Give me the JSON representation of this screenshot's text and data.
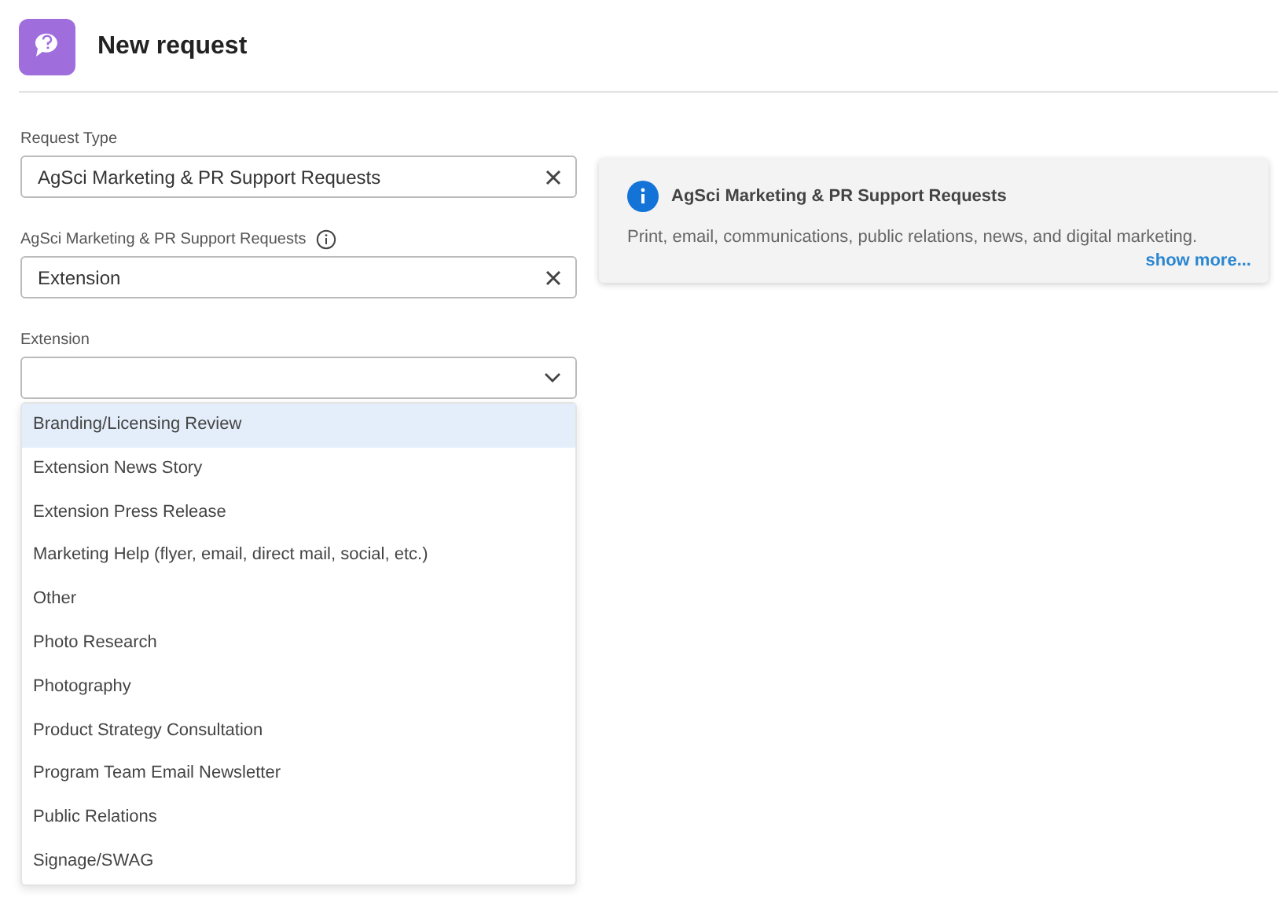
{
  "header": {
    "title": "New request"
  },
  "fields": [
    {
      "kind": "select",
      "label": "Request Type",
      "value": "AgSci Marketing & PR Support Requests",
      "info": false,
      "clearable": true,
      "expanded": false
    },
    {
      "kind": "select",
      "label": "AgSci Marketing & PR Support Requests",
      "value": "Extension",
      "info": true,
      "clearable": true,
      "expanded": false
    },
    {
      "kind": "select",
      "label": "Extension",
      "info": false,
      "clearable": false,
      "expanded": true
    }
  ],
  "dropdown": {
    "options": [
      {
        "label": "Branding/Licensing Review",
        "selected": true
      },
      {
        "label": "Extension News Story",
        "selected": false
      },
      {
        "label": "Extension Press Release",
        "selected": false
      },
      {
        "label": "Marketing Help (flyer, email, direct mail, social, etc.)",
        "selected": false
      },
      {
        "label": "Other",
        "selected": false
      },
      {
        "label": "Photo Research",
        "selected": false
      },
      {
        "label": "Photography",
        "selected": false
      },
      {
        "label": "Product Strategy Consultation",
        "selected": false
      },
      {
        "label": "Program Team Email Newsletter",
        "selected": false
      },
      {
        "label": "Public Relations",
        "selected": false
      },
      {
        "label": "Signage/SWAG",
        "selected": false
      }
    ]
  },
  "info_card": {
    "title": "AgSci Marketing & PR Support Requests",
    "description": "Print, email, communications, public relations, news, and digital marketing.",
    "link": "show more..."
  }
}
